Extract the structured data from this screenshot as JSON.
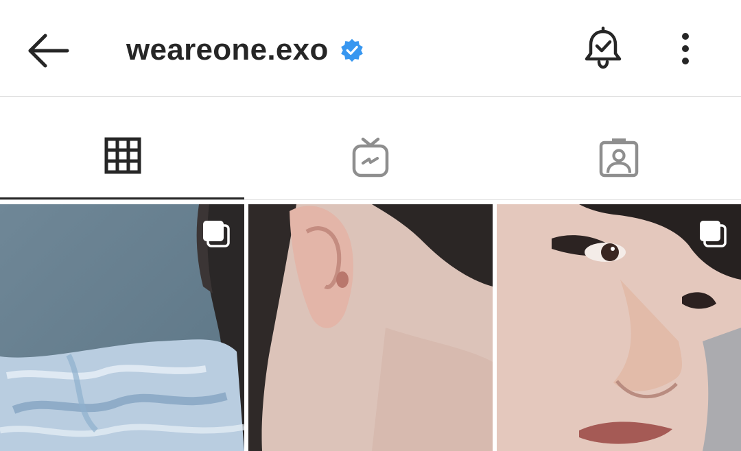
{
  "header": {
    "username": "weareone.exo",
    "verified": true,
    "icons": {
      "back": "arrow-left-icon",
      "verified": "verified-badge-icon",
      "notifications": "bell-check-icon",
      "more": "more-vertical-icon"
    }
  },
  "tabs": [
    {
      "id": "posts",
      "icon": "grid-icon",
      "active": true
    },
    {
      "id": "igtv",
      "icon": "igtv-icon",
      "active": false
    },
    {
      "id": "tagged",
      "icon": "tagged-person-icon",
      "active": false
    }
  ],
  "grid": [
    {
      "id": "post-1",
      "multi": true
    },
    {
      "id": "post-2",
      "multi": false
    },
    {
      "id": "post-3",
      "multi": true
    }
  ],
  "colors": {
    "text": "#262626",
    "muted": "#8e8e8e",
    "verified": "#3897f0",
    "divider": "#dbdbdb"
  }
}
